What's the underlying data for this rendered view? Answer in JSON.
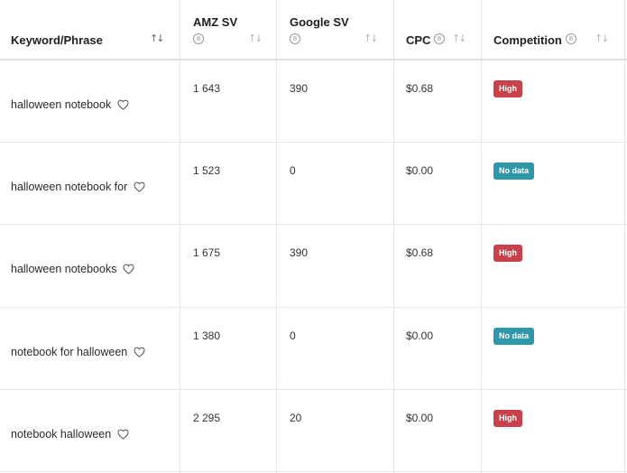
{
  "header": {
    "keyword": "Keyword/Phrase",
    "amz_sv": "AMZ SV",
    "google_sv": "Google SV",
    "cpc": "CPC",
    "competition": "Competition",
    "info_glyph": "8",
    "sort_glyph": "↑↓"
  },
  "rows": [
    {
      "keyword": "halloween notebook",
      "amz_sv": "1 643",
      "google_sv": "390",
      "cpc": "$0.68",
      "competition": "High",
      "competition_color": "#c9414b"
    },
    {
      "keyword": "halloween notebook for",
      "amz_sv": "1 523",
      "google_sv": "0",
      "cpc": "$0.00",
      "competition": "No data",
      "competition_color": "#2f97a8"
    },
    {
      "keyword": "halloween notebooks",
      "amz_sv": "1 675",
      "google_sv": "390",
      "cpc": "$0.68",
      "competition": "High",
      "competition_color": "#c9414b"
    },
    {
      "keyword": "notebook for halloween",
      "amz_sv": "1 380",
      "google_sv": "0",
      "cpc": "$0.00",
      "competition": "No data",
      "competition_color": "#2f97a8"
    },
    {
      "keyword": "notebook halloween",
      "amz_sv": "2 295",
      "google_sv": "20",
      "cpc": "$0.00",
      "competition": "High",
      "competition_color": "#c9414b"
    }
  ]
}
